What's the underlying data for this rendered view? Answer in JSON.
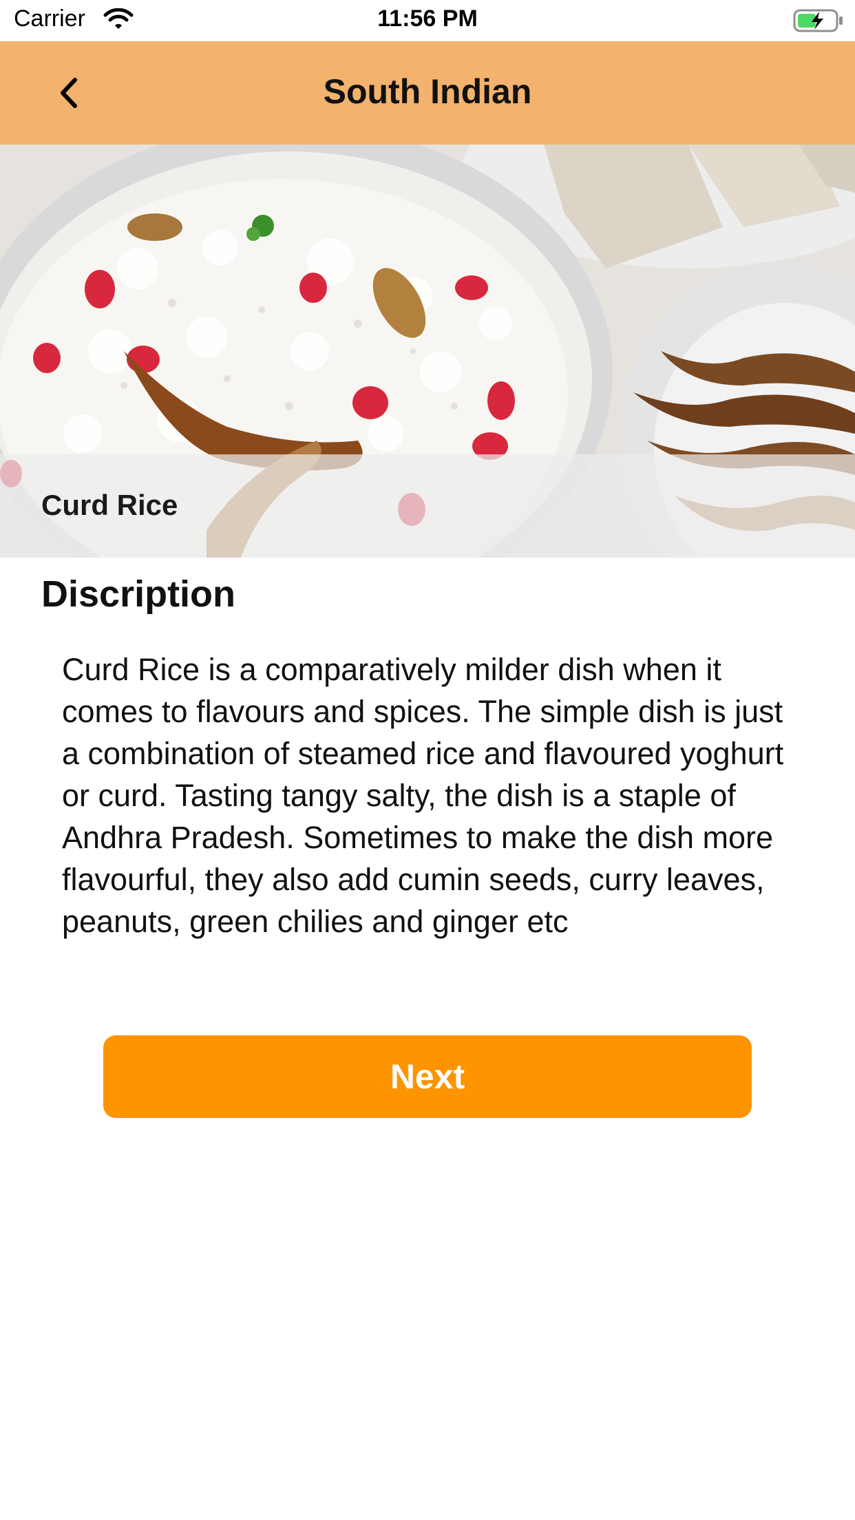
{
  "status_bar": {
    "carrier": "Carrier",
    "time": "11:56 PM",
    "wifi_icon": "wifi-icon",
    "battery_icon": "battery-charging-icon"
  },
  "nav": {
    "title": "South Indian",
    "back_icon": "chevron-left-icon",
    "background_color": "#f3b26d"
  },
  "hero": {
    "caption": "Curd Rice"
  },
  "description": {
    "heading": "Discription",
    "body": "Curd Rice is a comparatively milder dish when it comes to flavours and spices. The simple dish is just a combination of steamed rice and flavoured yoghurt or curd. Tasting tangy salty, the dish is a staple of Andhra Pradesh. Sometimes to make the dish more flavourful, they also add cumin seeds, curry leaves, peanuts, green chilies and ginger etc"
  },
  "actions": {
    "next_label": "Next",
    "next_color": "#fd9400"
  }
}
